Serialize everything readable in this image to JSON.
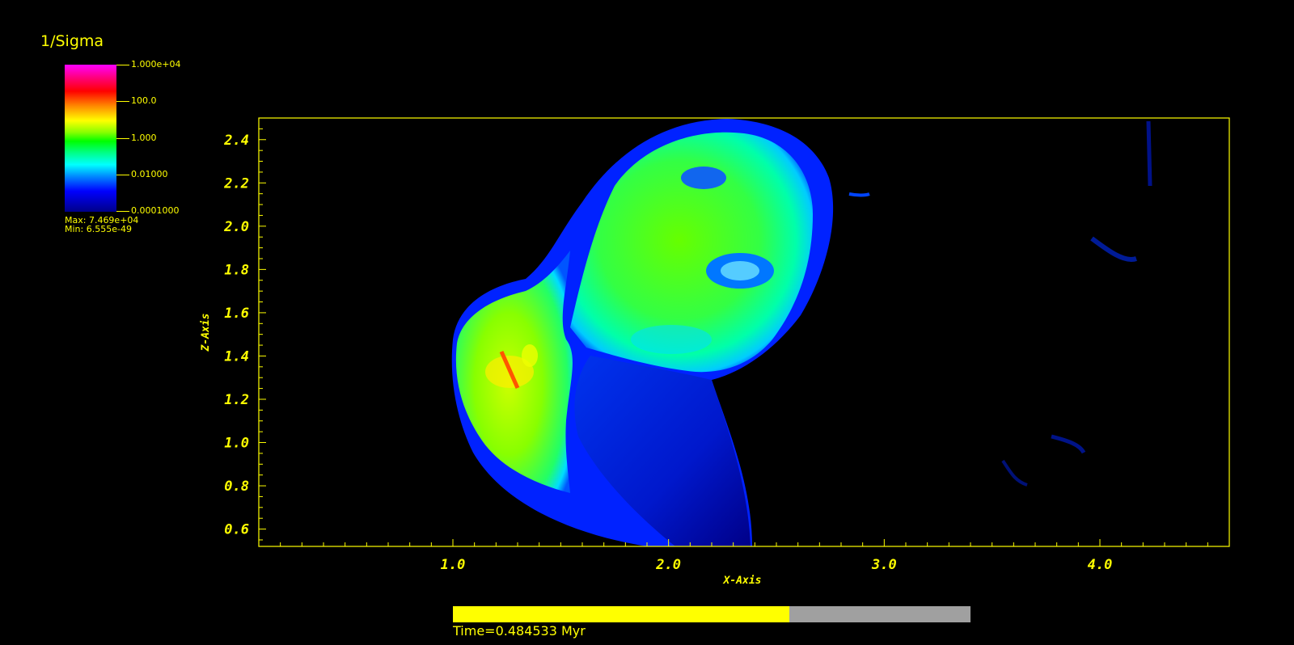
{
  "legend": {
    "title": "1/Sigma",
    "ticks": [
      "1.000e+04",
      "100.0",
      "1.000",
      "0.01000",
      "0.0001000"
    ],
    "max_label": "Max:  7.469e+04",
    "min_label": "Min:  6.555e-49"
  },
  "chart_data": {
    "type": "heatmap",
    "title": "",
    "xlabel": "X-Axis",
    "ylabel": "Z-Axis",
    "xlim": [
      0.1,
      4.6
    ],
    "ylim": [
      0.52,
      2.5
    ],
    "x_tick_labels": [
      "1.0",
      "2.0",
      "3.0",
      "4.0"
    ],
    "x_tick_values": [
      1.0,
      2.0,
      3.0,
      4.0
    ],
    "y_tick_labels": [
      "2.4",
      "2.2",
      "2.0",
      "1.8",
      "1.6",
      "1.4",
      "1.2",
      "1.0",
      "0.8",
      "0.6"
    ],
    "y_tick_values": [
      2.4,
      2.2,
      2.0,
      1.8,
      1.6,
      1.4,
      1.2,
      1.0,
      0.8,
      0.6
    ],
    "colorscale": "log",
    "color_range": [
      0.0001,
      10000
    ],
    "max_value": 74690,
    "min_value": 6.555e-49
  },
  "time": {
    "label": "Time=0.484533 Myr",
    "progress": 0.65
  },
  "colors": {
    "axis": "#ffff00",
    "background": "#000000"
  }
}
